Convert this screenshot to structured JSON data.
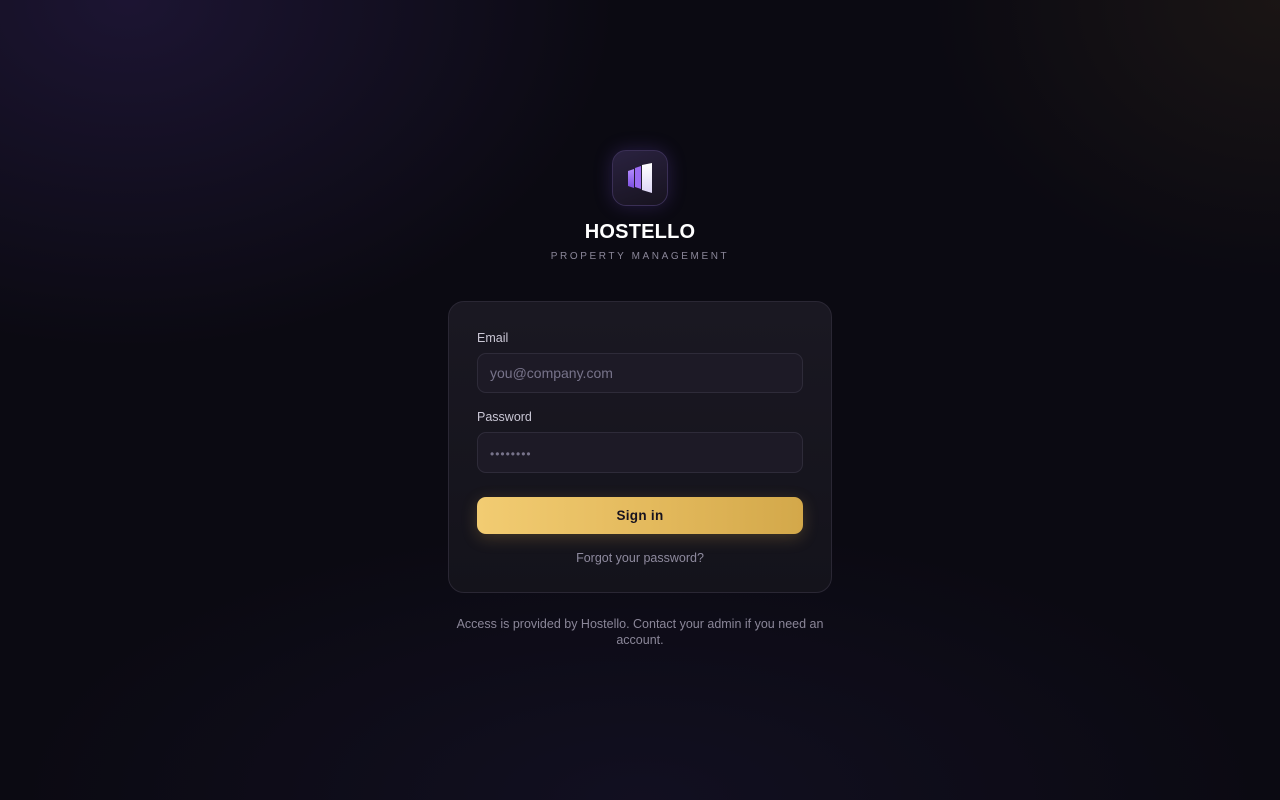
{
  "brand": {
    "logo_icon": "building-logo-icon",
    "name": "HOSTELLO",
    "subtitle": "PROPERTY MANAGEMENT"
  },
  "login_form": {
    "email": {
      "label": "Email",
      "placeholder": "you@company.com",
      "value": ""
    },
    "password": {
      "label": "Password",
      "placeholder": "••••••••",
      "value": ""
    },
    "submit_label": "Sign in",
    "forgot_label": "Forgot your password?"
  },
  "footnote": "Access is provided by Hostello. Contact your admin if you need an account.",
  "colors": {
    "background": "#0b0a12",
    "card": "#17151e",
    "accent_gold": "#e6bd62",
    "logo_purple": "#8b5cf6"
  }
}
